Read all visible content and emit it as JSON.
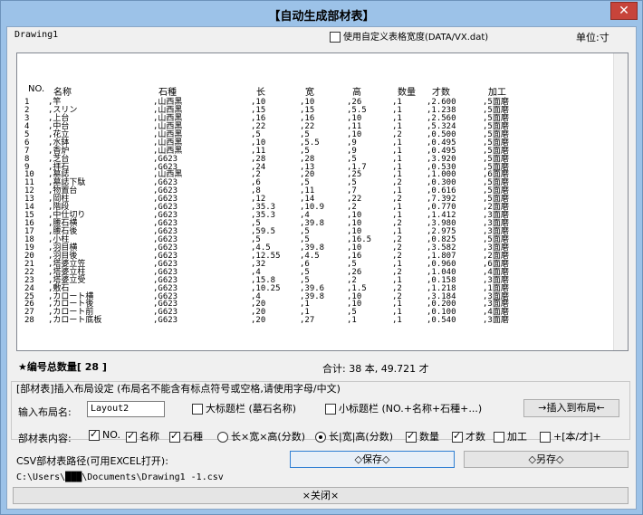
{
  "window": {
    "title": "【自动生成部材表】",
    "close_label": "✕"
  },
  "top": {
    "drawing_name": "Drawing1",
    "custom_width_label": "使用自定义表格宽度(DATA/VX.dat)",
    "unit_label": "单位:寸"
  },
  "table": {
    "headers": [
      "NO.",
      "名称",
      "石種",
      "长",
      "宽",
      "高",
      "数量",
      "才数",
      "加工"
    ],
    "rows": [
      [
        "1",
        ",竿",
        ",山西黑",
        ",10",
        ",10",
        ",26",
        ",1",
        ",2.600",
        ",5面磨"
      ],
      [
        "2",
        ",スリン",
        ",山西黑",
        ",15",
        ",15",
        ",5.5",
        ",1",
        ",1.238",
        ",5面磨"
      ],
      [
        "3",
        ",上台",
        ",山西黑",
        ",16",
        ",16",
        ",10",
        ",1",
        ",2.560",
        ",5面磨"
      ],
      [
        "4",
        ",中台",
        ",山西黑",
        ",22",
        ",22",
        ",11",
        ",1",
        ",5.324",
        ",5面磨"
      ],
      [
        "5",
        ",花立",
        ",山西黑",
        ",5",
        ",5",
        ",10",
        ",2",
        ",0.500",
        ",5面磨"
      ],
      [
        "6",
        ",水鉢",
        ",山西黑",
        ",10",
        ",5.5",
        ",9",
        ",1",
        ",0.495",
        ",5面磨"
      ],
      [
        "7",
        ",香炉",
        ",山西黑",
        ",11",
        ",5",
        ",9",
        ",1",
        ",0.495",
        ",5面磨"
      ],
      [
        "8",
        ",芝台",
        ",G623",
        ",28",
        ",28",
        ",5",
        ",1",
        ",3.920",
        ",5面磨"
      ],
      [
        "9",
        ",拝石",
        ",G623",
        ",24",
        ",13",
        ",1.7",
        ",1",
        ",0.530",
        ",5面磨"
      ],
      [
        "10",
        ",墓誌",
        ",山西黑",
        ",2",
        ",20",
        ",25",
        ",1",
        ",1.000",
        ",6面磨"
      ],
      [
        "11",
        ",墓誌下駄",
        ",G623",
        ",6",
        ",5",
        ",5",
        ",2",
        ",0.300",
        ",5面磨"
      ],
      [
        "12",
        ",物置台",
        ",G623",
        ",8",
        ",11",
        ",7",
        ",1",
        ",0.616",
        ",5面磨"
      ],
      [
        "13",
        ",岡柱",
        ",G623",
        ",12",
        ",14",
        ",22",
        ",2",
        ",7.392",
        ",5面磨"
      ],
      [
        "14",
        ",階段",
        ",G623",
        ",35.3",
        ",10.9",
        ",2",
        ",1",
        ",0.770",
        ",2面磨"
      ],
      [
        "15",
        ",中仕切り",
        ",G623",
        ",35.3",
        ",4",
        ",10",
        ",1",
        ",1.412",
        ",3面磨"
      ],
      [
        "16",
        ",腰石横",
        ",G623",
        ",5",
        ",39.8",
        ",10",
        ",2",
        ",3.980",
        ",3面磨"
      ],
      [
        "17",
        ",腰石後",
        ",G623",
        ",59.5",
        ",5",
        ",10",
        ",1",
        ",2.975",
        ",3面磨"
      ],
      [
        "18",
        ",小柱",
        ",G623",
        ",5",
        ",5",
        ",16.5",
        ",2",
        ",0.825",
        ",5面磨"
      ],
      [
        "19",
        ",羽目横",
        ",G623",
        ",4.5",
        ",39.8",
        ",10",
        ",2",
        ",3.582",
        ",3面磨"
      ],
      [
        "20",
        ",羽目後",
        ",G623",
        ",12.55",
        ",4.5",
        ",16",
        ",2",
        ",1.807",
        ",2面磨"
      ],
      [
        "21",
        ",塔婆立笠",
        ",G623",
        ",32",
        ",6",
        ",5",
        ",1",
        ",0.960",
        ",6面磨"
      ],
      [
        "22",
        ",塔婆立柱",
        ",G623",
        ",4",
        ",5",
        ",26",
        ",2",
        ",1.040",
        ",4面磨"
      ],
      [
        "23",
        ",塔婆立受",
        ",G623",
        ",15.8",
        ",5",
        ",2",
        ",1",
        ",0.158",
        ",3面磨"
      ],
      [
        "24",
        ",敷石",
        ",G623",
        ",10.25",
        ",39.6",
        ",1.5",
        ",2",
        ",1.218",
        ",1面磨"
      ],
      [
        "25",
        ",カロート横",
        ",G623",
        ",4",
        ",39.8",
        ",10",
        ",2",
        ",3.184",
        ",3面磨"
      ],
      [
        "26",
        ",カロート後",
        ",G623",
        ",20",
        ",1",
        ",10",
        ",1",
        ",0.200",
        ",3面磨"
      ],
      [
        "27",
        ",カロート前",
        ",G623",
        ",20",
        ",1",
        ",5",
        ",1",
        ",0.100",
        ",4面磨"
      ],
      [
        "28",
        ",カロート底板",
        ",G623",
        ",20",
        ",27",
        ",1",
        ",1",
        ",0.540",
        ",3面磨"
      ]
    ]
  },
  "summary": {
    "total_count_label": "★编号总数量[ 28 ]",
    "totals_label": "合计: 38 本, 49.721 才"
  },
  "layout_settings": {
    "heading": "[部材表]插入布局设定 (布局名不能含有标点符号或空格,请使用字母/中文)",
    "layout_name_label": "输入布局名:",
    "layout_name_value": "Layout2",
    "large_title_label": "大标题栏 (墓石名称)",
    "small_title_label": "小标题栏 (NO.+名称+石種+...)",
    "insert_button": "→插入到布局←"
  },
  "content_options": {
    "label": "部材表内容:",
    "no": "NO.",
    "name": "名称",
    "stone": "石種",
    "radio_a": "长×宽×高(分数)",
    "radio_b": "长|宽|高(分数)",
    "qty": "数量",
    "sai": "才数",
    "process": "加工",
    "extra": "+[本/才]+"
  },
  "csv": {
    "label": "CSV部材表路径(可用EXCEL打开):",
    "save_button": "◇保存◇",
    "save_as_button": "◇另存◇",
    "path": "C:\\Users\\███\\Documents\\Drawing1 -1.csv"
  },
  "footer": {
    "close_button": "×关闭×"
  }
}
